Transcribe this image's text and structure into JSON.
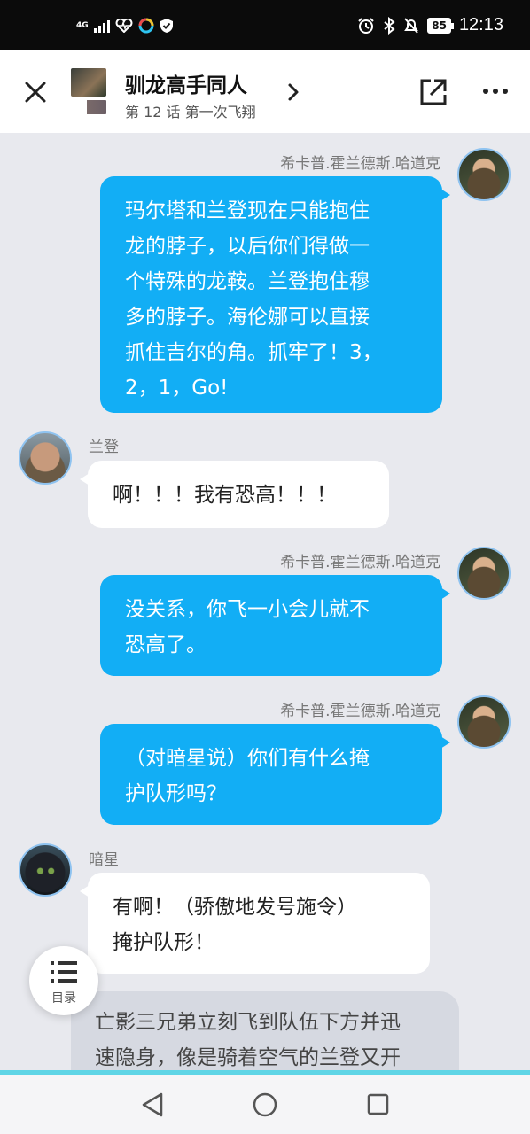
{
  "status_bar": {
    "network": "4G",
    "signal_sub": "4G",
    "battery": "85",
    "time": "12:13"
  },
  "header": {
    "title": "驯龙高手同人",
    "subtitle": "第 12 话 第一次飞翔"
  },
  "messages": [
    {
      "side": "right",
      "speaker": "希卡普.霍兰德斯.哈道克",
      "avatar": "hiccup",
      "lines": [
        "玛尔塔和兰登现在只能抱住",
        "龙的脖子，以后你们得做一",
        "个特殊的龙鞍。兰登抱住穆",
        "多的脖子。海伦娜可以直接",
        "抓住吉尔的角。抓牢了！3，",
        "2，1，Go!"
      ]
    },
    {
      "side": "left",
      "speaker": "兰登",
      "avatar": "fishlegs",
      "lines": [
        "啊！！！我有恐高！！！"
      ]
    },
    {
      "side": "right",
      "speaker": "希卡普.霍兰德斯.哈道克",
      "avatar": "hiccup",
      "lines": [
        "没关系，你飞一小会儿就不",
        "恐高了。"
      ]
    },
    {
      "side": "right",
      "speaker": "希卡普.霍兰德斯.哈道克",
      "avatar": "hiccup",
      "lines": [
        "（对暗星说）你们有什么掩",
        "护队形吗？"
      ]
    },
    {
      "side": "left",
      "speaker": "暗星",
      "avatar": "toothless",
      "lines": [
        "有啊！（骄傲地发号施令）",
        "掩护队形！"
      ]
    },
    {
      "side": "narration",
      "lines": [
        "亡影三兄弟立刻飞到队伍下方并迅",
        "速隐身，像是骑着空气的兰登又开"
      ]
    }
  ],
  "toc": {
    "label": "目录"
  },
  "nav": {
    "back": "back",
    "home": "home",
    "recent": "recent"
  }
}
